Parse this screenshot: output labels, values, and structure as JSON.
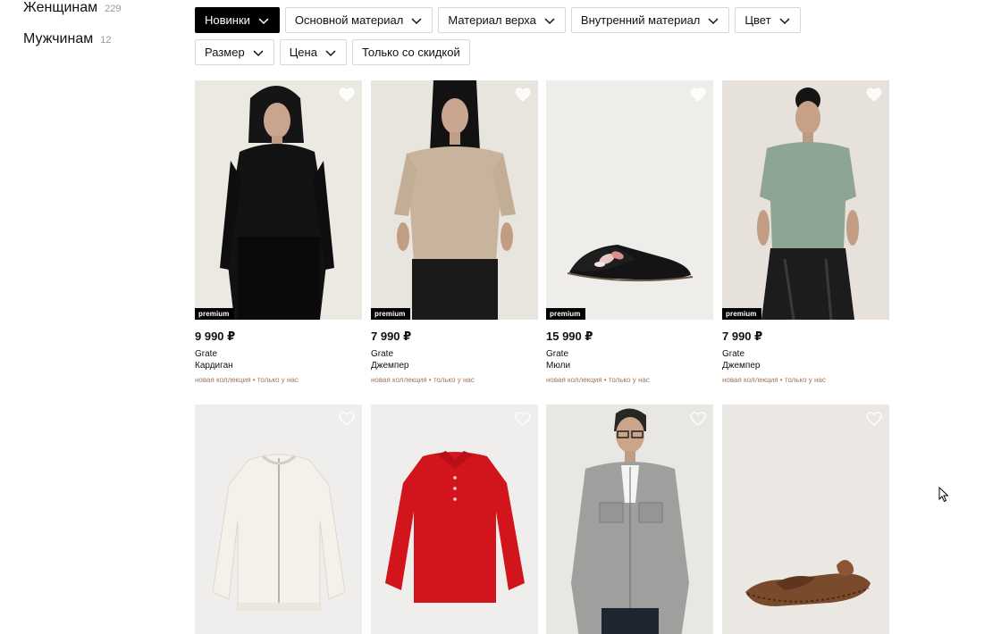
{
  "sidebar": {
    "categories": [
      {
        "label": "Женщинам",
        "count": "229"
      },
      {
        "label": "Мужчинам",
        "count": "12"
      }
    ]
  },
  "filters": [
    {
      "label": "Новинки",
      "active": true
    },
    {
      "label": "Основной материал"
    },
    {
      "label": "Материал верха"
    },
    {
      "label": "Внутренний материал"
    },
    {
      "label": "Цвет"
    },
    {
      "label": "Размер"
    },
    {
      "label": "Цена"
    },
    {
      "label": "Только со скидкой"
    }
  ],
  "products": [
    {
      "price": "9 990 ₽",
      "brand": "Grate",
      "type": "Кардиган",
      "badge": "premium",
      "tag1": "новая коллекция",
      "tag2": "только у нас",
      "image": "woman-black-cardigan"
    },
    {
      "price": "7 990 ₽",
      "brand": "Grate",
      "type": "Джемпер",
      "badge": "premium",
      "tag1": "новая коллекция",
      "tag2": "только у нас",
      "image": "woman-beige-jumper"
    },
    {
      "price": "15 990 ₽",
      "brand": "Grate",
      "type": "Мюли",
      "badge": "premium",
      "tag1": "новая коллекция",
      "tag2": "только у нас",
      "image": "black-embroidered-mule"
    },
    {
      "price": "7 990 ₽",
      "brand": "Grate",
      "type": "Джемпер",
      "badge": "premium",
      "tag1": "новая коллекция",
      "tag2": "только у нас",
      "image": "woman-green-knit-top"
    },
    {
      "image": "white-zip-cardigan"
    },
    {
      "image": "red-polo-sweater"
    },
    {
      "image": "man-grey-shirt-jacket"
    },
    {
      "image": "brown-leather-flat"
    }
  ],
  "colors": {
    "tag": "#a0765a",
    "chip_active_bg": "#000000",
    "chip_border": "#d8d8d8"
  },
  "icons": {
    "favorite": "heart-outline-icon",
    "dropdown": "chevron-down-icon"
  }
}
